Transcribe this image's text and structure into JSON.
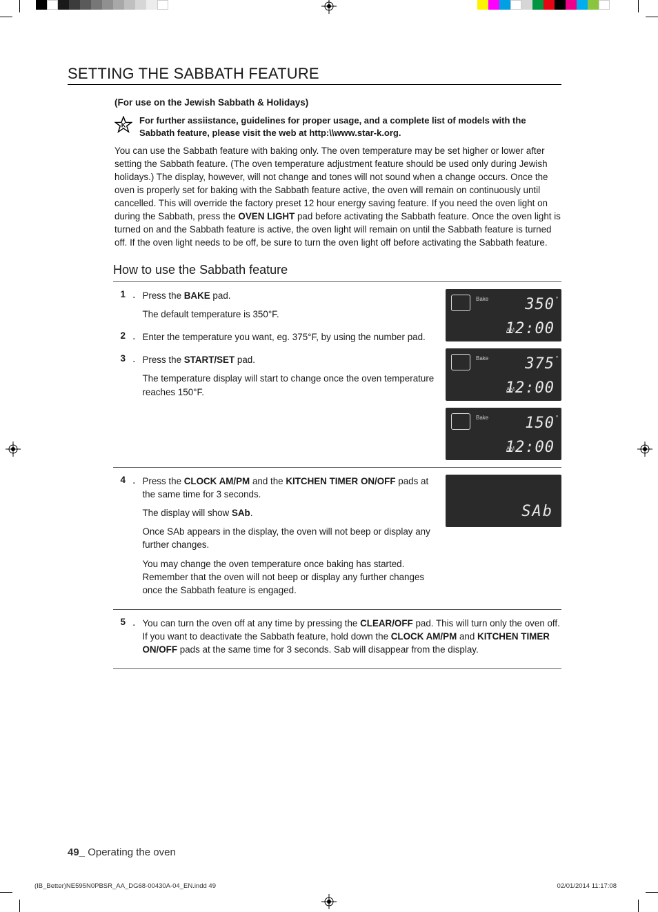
{
  "title": "SETTING THE SABBATH FEATURE",
  "subtitle": "(For use on the Jewish Sabbath & Holidays)",
  "assist": "For further assiistance, guidelines for proper usage, and a complete list of models with the Sabbath feature, please visit the web at http:\\\\www.star-k.org.",
  "intro_a": "You can use the Sabbath feature with baking only. The oven temperature may be set higher or lower after setting the Sabbath feature. (The oven temperature adjustment feature should be used only during Jewish holidays.) The display, however, will not change and tones will not sound when a change occurs. Once the oven is properly set for baking with the Sabbath feature active, the oven will remain on continuously until cancelled. This will override the factory preset 12 hour energy saving feature. If you need the oven light on during the Sabbath, press the ",
  "intro_bold1": "OVEN LIGHT",
  "intro_b": " pad before activating the Sabbath feature. Once the oven light is turned on and the Sabbath feature is active, the oven light will remain on until the Sabbath feature is turned off. If the oven light needs to be off, be sure to turn the oven light off before activating the Sabbath feature.",
  "howto": "How to use the Sabbath feature",
  "steps": {
    "s1n": "1",
    "s1a": "Press the ",
    "s1b": "BAKE",
    "s1c": " pad.",
    "s1d": "The default temperature is 350°F.",
    "s2n": "2",
    "s2a": "Enter the temperature you want, eg. 375°F, by using the number pad.",
    "s3n": "3",
    "s3a": "Press the ",
    "s3b": "START/SET",
    "s3c": " pad.",
    "s3d": "The temperature display will start to change once the oven temperature reaches 150°F.",
    "s4n": "4",
    "s4a": "Press the ",
    "s4b": "CLOCK AM/PM",
    "s4c": " and the ",
    "s4d": "KITCHEN TIMER ON/OFF",
    "s4e": " pads at the same time for 3 seconds.",
    "s4f": "The display will show ",
    "s4g": "SAb",
    "s4h": ".",
    "s4i": "Once SAb appears in the display, the oven will not beep or display any further changes.",
    "s4j": "You may change the oven temperature once baking has started. Remember that the oven will not beep or display any further changes once the Sabbath feature is engaged.",
    "s5n": "5",
    "s5a": "You can turn the oven off at any time by pressing the ",
    "s5b": "CLEAR/OFF",
    "s5c": " pad. This will turn only the oven off. If you want to deactivate the Sabbath feature, hold down the ",
    "s5d": "CLOCK AM/PM",
    "s5e": " and ",
    "s5f": "KITCHEN TIMER ON/OFF",
    "s5g": " pads at the same time for 3 seconds. Sab will disappear from the display."
  },
  "displays": {
    "bake_label": "Bake",
    "am": "AM",
    "clock": "12:00",
    "t1": "350",
    "t2": "375",
    "t3": "150",
    "sab": "SAb"
  },
  "footer_page": "49_",
  "footer_section": " Operating the oven",
  "slug_left": "(IB_Better)NE595N0PBSR_AA_DG68-00430A-04_EN.indd   49",
  "slug_right": "02/01/2014   11:17:08",
  "colorbar_left": [
    "#000",
    "#fff",
    "#1a1a1a",
    "#3c3c3c",
    "#5a5a5a",
    "#777",
    "#909090",
    "#a8a8a8",
    "#bfbfbf",
    "#d6d6d6",
    "#ececec",
    "#fff"
  ],
  "colorbar_right": [
    "#fff200",
    "#ff00ff",
    "#00a0e3",
    "#fff",
    "#d6d6d6",
    "#009640",
    "#e30613",
    "#000",
    "#ec008c",
    "#00aeef",
    "#8bc53f",
    "#fff"
  ]
}
